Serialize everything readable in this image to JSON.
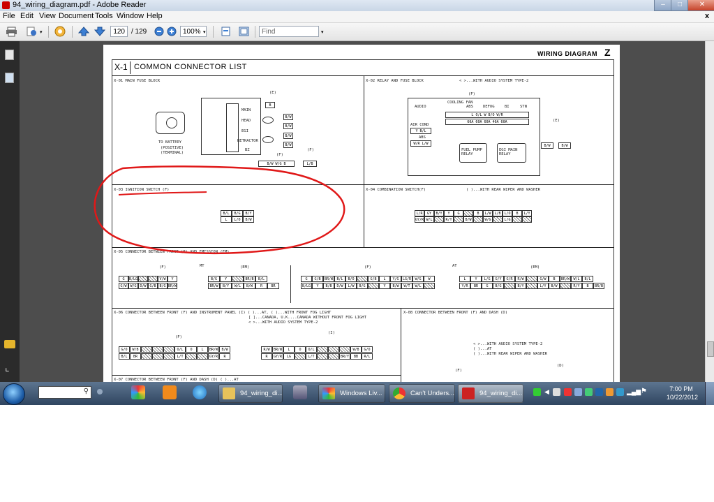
{
  "window": {
    "title": "94_wiring_diagram.pdf - Adobe Reader",
    "close_x": "x"
  },
  "menu": [
    "File",
    "Edit",
    "View",
    "Document",
    "Tools",
    "Window",
    "Help"
  ],
  "toolbar": {
    "page_current": "120",
    "page_sep": "/ 129",
    "zoom": "100%",
    "find_placeholder": "Find"
  },
  "doc": {
    "header_right": "WIRING DIAGRAM",
    "header_letter": "Z",
    "section_id": "X-1",
    "section_title": "COMMON CONNECTOR LIST",
    "x01": {
      "title": "X-01  MAIN FUSE BLOCK",
      "to_battery": "TO BATTERY",
      "positive": "(POSITIVE)",
      "terminal": "(TERMINAL)",
      "main": "MAIN",
      "head": "HEAD",
      "egi": "EGI",
      "retractor": "RETRACTOR",
      "bz": "BZ",
      "e": "(E)",
      "f": "(F)"
    },
    "x02": {
      "title": "X-02  RELAY AND FUSE BLOCK",
      "note": "< >...WITH AUDIO SYSTEM TYPE-2",
      "f": "(F)",
      "e": "(E)",
      "labels": [
        "AUDIO",
        "COOLING FAN",
        "ABS",
        "DEFOG",
        "BI",
        "STN"
      ],
      "air_cond": "AIR COND",
      "abs": "ABS",
      "fuel_pump": "FUEL PUMP RELAY",
      "egi_main": "EGI MAIN RELAY",
      "pins": [
        "B/W",
        "B/W"
      ]
    },
    "x03": {
      "title": "X-03  IGNITION SWITCH  (F)",
      "row1": [
        "B/L",
        "B/G",
        "B/Y"
      ],
      "row2": [
        "L",
        "L/O",
        "B/W"
      ]
    },
    "x04": {
      "title": "X-04  COMBINATION SWITCH(F)",
      "note": "( )...WITH REAR WIPER AND WASHER",
      "row1": [
        "L/R",
        "GY",
        "B/Y",
        "Y",
        "G",
        "",
        "B",
        "L/W",
        "L/B",
        "L/O",
        "B",
        "L/Y"
      ],
      "row2": [
        "GY/R",
        "W/L",
        "",
        "R/Y",
        "",
        "B/W",
        "",
        "W/G",
        "",
        "L/G",
        "",
        ""
      ]
    },
    "x05": {
      "title": "X-05  CONNECTOR BETWEEN FRONT (F) AND EMISSION (EM)",
      "mt": "MT",
      "at": "AT",
      "f": "(F)",
      "em": "(EM)",
      "mt_f1": [
        "G",
        "B/LG",
        "",
        "",
        "V/W",
        "Y"
      ],
      "mt_f2": [
        "G/W",
        "W/G",
        "D/W",
        "G/B",
        "B/G",
        "BR/W"
      ],
      "mt_em1": [
        "B/G",
        "Y",
        "",
        "BR/B",
        "B/L"
      ],
      "mt_em2": [
        "BR/W",
        "B/Y",
        "W/L",
        "B/W",
        "R",
        "BR"
      ],
      "at_f1": [
        "G",
        "G/B",
        "BR/W",
        "B/L",
        "B/O",
        "",
        "G/B",
        "L",
        "Y/G",
        "LG/R",
        "W/G",
        "W"
      ],
      "at_f2": [
        "B/LG",
        "Y",
        "B/B",
        "D/W",
        "L/W",
        "B/G",
        "",
        "Y",
        "B/W",
        "W/T",
        "W/L",
        ""
      ],
      "at_em1": [
        "L",
        "Y",
        "L/G",
        "G/Y",
        "G/R",
        "R/W",
        "",
        "G/W",
        "B",
        "BR/W",
        "W/L",
        "B/L"
      ],
      "at_em2": [
        "Y/R",
        "BR",
        "G",
        "B/G",
        "",
        "B/Y",
        "",
        "L/Y",
        "B/W",
        "",
        "R/Y",
        "B",
        "BR/B"
      ]
    },
    "x06": {
      "title": "X-06  CONNECTOR BETWEEN FRONT (F) AND INSTRUMENT PANEL (I)  ( )...AT,   ( )...WITH FRONT FOG LIGHT",
      "note2": "[ ]...CANADA, U.K....CANADA WITHOUT FRONT FOG LIGHT",
      "note3": "< >...WITH AUDIO SYSTEM TYPE-2",
      "f": "(F)",
      "i": "(I)",
      "f1": [
        "G/O",
        "W/B",
        "",
        "",
        "",
        "O/L",
        "O",
        "L",
        "BR/W",
        "B/W"
      ],
      "f2": [
        "B/L",
        "BR",
        "",
        "",
        "",
        "L/T",
        "",
        "",
        "GY/R",
        "R"
      ],
      "i1": [
        "R/W",
        "BR/W",
        "L",
        "O",
        "O/L",
        "",
        "",
        "",
        "W/B",
        "G/O"
      ],
      "i2": [
        "R",
        "GY/R",
        "LG",
        "",
        "L/T",
        "",
        "",
        "BR/Y",
        "BB",
        "R/L"
      ]
    },
    "x07": {
      "title": "X-07  CONNECTOR BETWEEN FRONT (F) AND DASH (D)  ( )...AT"
    },
    "x08": {
      "title": "X-08  CONNECTOR BETWEEN FRONT (F) AND DASH (D)",
      "note1": "< >...WITH AUDIO SYSTEM TYPE-2",
      "note2": "( )...AT",
      "note3": "( )...WITH REAR WIPER AND WASHER",
      "f": "(F)",
      "d": "(D)"
    }
  },
  "taskbar": {
    "items": [
      "94_wiring_di...",
      "Windows Liv...",
      "Can't Unders...",
      "94_wiring_di..."
    ],
    "clock_time": "7:00 PM",
    "clock_date": "10/22/2012"
  }
}
